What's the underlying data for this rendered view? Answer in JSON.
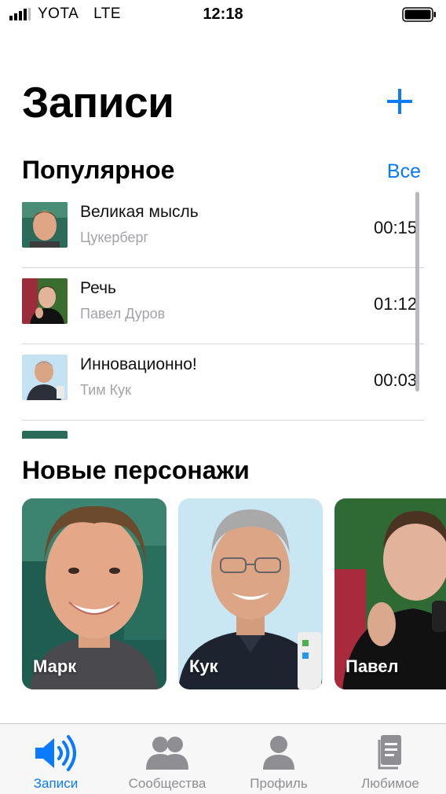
{
  "status_bar": {
    "carrier": "YOTA",
    "network": "LTE",
    "time": "12:18"
  },
  "header": {
    "title": "Записи",
    "add_icon": "plus-icon"
  },
  "popular": {
    "title": "Популярное",
    "see_all": "Все",
    "items": [
      {
        "name": "Великая мысль",
        "author": "Цукерберг",
        "duration": "00:15"
      },
      {
        "name": "Речь",
        "author": "Павел Дуров",
        "duration": "01:12"
      },
      {
        "name": "Инновационно!",
        "author": "Тим Кук",
        "duration": "00:03"
      }
    ]
  },
  "new_characters": {
    "title": "Новые персонажи",
    "cards": [
      {
        "name": "Марк"
      },
      {
        "name": "Кук"
      },
      {
        "name": "Павел"
      }
    ]
  },
  "tabs": [
    {
      "label": "Записи",
      "icon": "speaker-icon",
      "active": true
    },
    {
      "label": "Сообщества",
      "icon": "people-icon",
      "active": false
    },
    {
      "label": "Профиль",
      "icon": "person-icon",
      "active": false
    },
    {
      "label": "Любимое",
      "icon": "document-icon",
      "active": false
    }
  ],
  "colors": {
    "accent": "#0a7aff",
    "secondary_text": "#a3a3a8",
    "tab_inactive": "#8e8e93"
  }
}
